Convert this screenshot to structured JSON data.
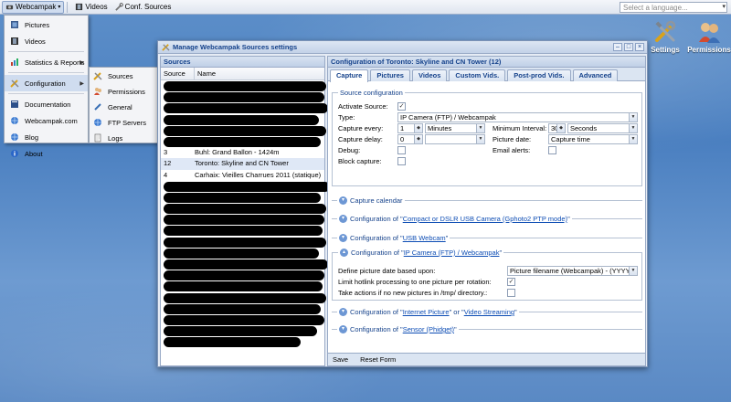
{
  "toolbar": {
    "app_label": "Webcampak",
    "videos_label": "Videos",
    "conf_sources_label": "Conf. Sources",
    "language_placeholder": "Select a language..."
  },
  "main_menu": {
    "items": [
      {
        "label": "Pictures"
      },
      {
        "label": "Videos"
      },
      {
        "label": "Statistics & Reports"
      },
      {
        "label": "Configuration"
      },
      {
        "label": "Documentation"
      },
      {
        "label": "Webcampak.com"
      },
      {
        "label": "Blog"
      },
      {
        "label": "About"
      }
    ]
  },
  "sub_menu": {
    "items": [
      {
        "label": "Sources"
      },
      {
        "label": "Permissions"
      },
      {
        "label": "General"
      },
      {
        "label": "FTP Servers"
      },
      {
        "label": "Logs"
      }
    ]
  },
  "desktop": {
    "settings_label": "Settings",
    "permissions_label": "Permissions"
  },
  "window": {
    "title": "Manage Webcampak Sources settings",
    "sources_panel": {
      "title": "Sources",
      "col_id": "Source ID",
      "col_name": "Name",
      "rows": [
        {
          "id": "",
          "name": "",
          "redacted": true
        },
        {
          "id": "",
          "name": "",
          "redacted": true
        },
        {
          "id": "",
          "name": "",
          "redacted": true
        },
        {
          "id": "",
          "name": "",
          "redacted": true
        },
        {
          "id": "",
          "name": "",
          "redacted": true
        },
        {
          "id": "",
          "name": "",
          "redacted": true
        },
        {
          "id": "3",
          "name": "Buhl: Grand Ballon - 1424m",
          "redacted": false
        },
        {
          "id": "12",
          "name": "Toronto: Skyline and CN Tower",
          "redacted": false
        },
        {
          "id": "4",
          "name": "Carhaix: Vieilles Charrues 2011 (statique)",
          "redacted": false
        },
        {
          "id": "",
          "name": "",
          "redacted": true
        },
        {
          "id": "",
          "name": "",
          "redacted": true
        },
        {
          "id": "",
          "name": "",
          "redacted": true
        },
        {
          "id": "",
          "name": "",
          "redacted": true
        },
        {
          "id": "",
          "name": "",
          "redacted": true
        },
        {
          "id": "",
          "name": "",
          "redacted": true
        },
        {
          "id": "",
          "name": "",
          "redacted": true
        },
        {
          "id": "",
          "name": "",
          "redacted": true
        },
        {
          "id": "",
          "name": "",
          "redacted": true
        },
        {
          "id": "",
          "name": "",
          "redacted": true
        },
        {
          "id": "",
          "name": "",
          "redacted": true
        },
        {
          "id": "",
          "name": "",
          "redacted": true
        },
        {
          "id": "",
          "name": "",
          "redacted": true
        },
        {
          "id": "",
          "name": "",
          "redacted": true
        },
        {
          "id": "",
          "name": "",
          "redacted": true
        }
      ]
    },
    "config_panel": {
      "title": "Configuration of Toronto: Skyline and CN Tower (12)",
      "tabs": [
        "Capture",
        "Pictures",
        "Videos",
        "Custom Vids.",
        "Post-prod Vids.",
        "Advanced"
      ],
      "source_config": {
        "legend": "Source configuration",
        "activate_label": "Activate Source:",
        "type_label": "Type:",
        "type_value": "IP Camera (FTP) / Webcampak",
        "capture_every_label": "Capture every:",
        "capture_every_value": "1",
        "capture_every_unit": "Minutes",
        "min_interval_label": "Minimum Interval:",
        "min_interval_value": "30",
        "min_interval_unit": "Seconds",
        "capture_delay_label": "Capture delay:",
        "capture_delay_value": "0",
        "picture_date_label": "Picture date:",
        "picture_date_value": "Capture time",
        "debug_label": "Debug:",
        "email_alerts_label": "Email alerts:",
        "block_capture_label": "Block capture:"
      },
      "capture_calendar": "Capture calendar",
      "config_prefix": "Configuration of \"",
      "config_suffix": "\"",
      "compact_link": "Compact or DSLR USB Camera (Gphoto2 PTP mode)",
      "usb_link": "USB Webcam",
      "ipcam_link": "IP Camera (FTP) / Webcampak",
      "ipcam": {
        "define_date_label": "Define picture date based upon:",
        "define_date_value": "Picture filename (Webcampak) - (YYYYMMDDHHMISS)",
        "limit_label": "Limit hotlink processing to one picture per rotation:",
        "actions_label": "Take actions if no new pictures in /tmp/ directory.:"
      },
      "internet_link": "Internet Picture",
      "or_text": "\" or \"",
      "video_link": "Video Streaming",
      "sensor_link": "Sensor (Phidget)",
      "footer": {
        "save": "Save",
        "reset": "Reset Form"
      }
    }
  }
}
